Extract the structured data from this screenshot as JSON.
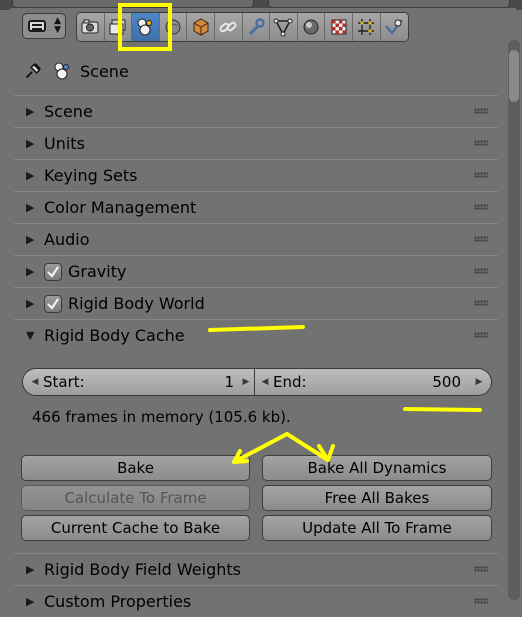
{
  "header": {
    "tabs": [
      {
        "icon": "render-icon"
      },
      {
        "icon": "render-layers-icon"
      },
      {
        "icon": "scene-icon",
        "active": true
      },
      {
        "icon": "world-icon"
      },
      {
        "icon": "object-icon"
      },
      {
        "icon": "constraints-icon"
      },
      {
        "icon": "modifiers-icon"
      },
      {
        "icon": "data-icon"
      },
      {
        "icon": "material-icon"
      },
      {
        "icon": "texture-icon"
      },
      {
        "icon": "particles-icon"
      },
      {
        "icon": "physics-icon"
      }
    ],
    "accent_active": "#4f86c6"
  },
  "context": {
    "label": "Scene"
  },
  "panels": [
    {
      "title": "Scene",
      "expanded": false
    },
    {
      "title": "Units",
      "expanded": false
    },
    {
      "title": "Keying Sets",
      "expanded": false
    },
    {
      "title": "Color Management",
      "expanded": false
    },
    {
      "title": "Audio",
      "expanded": false
    },
    {
      "title": "Gravity",
      "expanded": false,
      "checked": true
    },
    {
      "title": "Rigid Body World",
      "expanded": false,
      "checked": true
    },
    {
      "title": "Rigid Body Cache",
      "expanded": true
    },
    {
      "title": "Rigid Body Field Weights",
      "expanded": false
    },
    {
      "title": "Custom Properties",
      "expanded": false
    }
  ],
  "cache": {
    "start_label": "Start:",
    "start_value": "1",
    "end_label": "End:",
    "end_value": "500",
    "memory_text": "466 frames in memory (105.6 kb).",
    "buttons": {
      "bake": "Bake",
      "bake_all": "Bake All Dynamics",
      "calc_to_frame": "Calculate To Frame",
      "free_all": "Free All Bakes",
      "cache_to_bake": "Current Cache to Bake",
      "update_all": "Update All To Frame"
    }
  },
  "annotation_color": "#ffff00"
}
